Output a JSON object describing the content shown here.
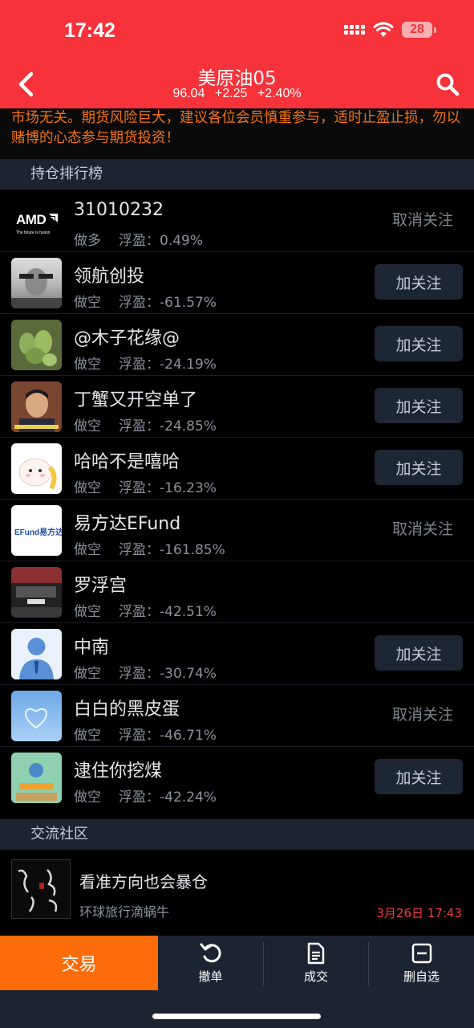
{
  "status": {
    "time": "17:42",
    "battery": "28"
  },
  "header": {
    "title": "美原油05",
    "price": "96.04",
    "change": "+2.25",
    "change_pct": "+2.40%"
  },
  "notice": {
    "text": "市场无关。期货风险巨大，建议各位会员慎重参与，适时止盈止损，勿以赌博的心态参与期货投资！"
  },
  "ranking": {
    "title": "持仓排行榜",
    "float_label": "浮盈：",
    "rows": [
      {
        "name": "31010232",
        "direction": "做多",
        "pnl": "0.49%",
        "action": "取消关注",
        "followed": true,
        "avatar": "amd-logo",
        "logo_text": "AMD",
        "logo_sub": "The future is fusion"
      },
      {
        "name": "领航创投",
        "direction": "做空",
        "pnl": "-61.57%",
        "action": "加关注",
        "followed": false,
        "avatar": "man-photo"
      },
      {
        "name": "@木子花缘@",
        "direction": "做空",
        "pnl": "-24.19%",
        "action": "加关注",
        "followed": false,
        "avatar": "succulent-photo"
      },
      {
        "name": "丁蟹又开空单了",
        "direction": "做空",
        "pnl": "-24.85%",
        "action": "加关注",
        "followed": false,
        "avatar": "tv-actor-photo"
      },
      {
        "name": "哈哈不是嘻哈",
        "direction": "做空",
        "pnl": "-16.23%",
        "action": "加关注",
        "followed": false,
        "avatar": "cartoon-sheep"
      },
      {
        "name": "易方达EFund",
        "direction": "做空",
        "pnl": "-161.85%",
        "action": "取消关注",
        "followed": true,
        "avatar": "efund-logo",
        "logo_text": "EFund易方达"
      },
      {
        "name": "罗浮宫",
        "direction": "做空",
        "pnl": "-42.51%",
        "action": "",
        "followed": false,
        "avatar": "car-photo"
      },
      {
        "name": "中南",
        "direction": "做空",
        "pnl": "-30.74%",
        "action": "加关注",
        "followed": false,
        "avatar": "default-user-avatar"
      },
      {
        "name": "白白的黑皮蛋",
        "direction": "做空",
        "pnl": "-46.71%",
        "action": "取消关注",
        "followed": true,
        "avatar": "sky-heart-photo"
      },
      {
        "name": "逮住你挖煤",
        "direction": "做空",
        "pnl": "-42.24%",
        "action": "加关注",
        "followed": false,
        "avatar": "game-screenshot"
      }
    ]
  },
  "community": {
    "title": "交流社区",
    "post": {
      "title": "看准方向也会暴仓",
      "author": "环球旅行滴蜗牛",
      "date": "3月26日 17:43",
      "avatar": "calligraphy-avatar"
    }
  },
  "bottom": {
    "trade": "交易",
    "cancel": "撤单",
    "deals": "成交",
    "remove_watch": "删自选"
  },
  "colors": {
    "header": "#f6323a",
    "trade": "#fd6c0b",
    "notice": "#f5740e",
    "date": "#f23a3a"
  }
}
